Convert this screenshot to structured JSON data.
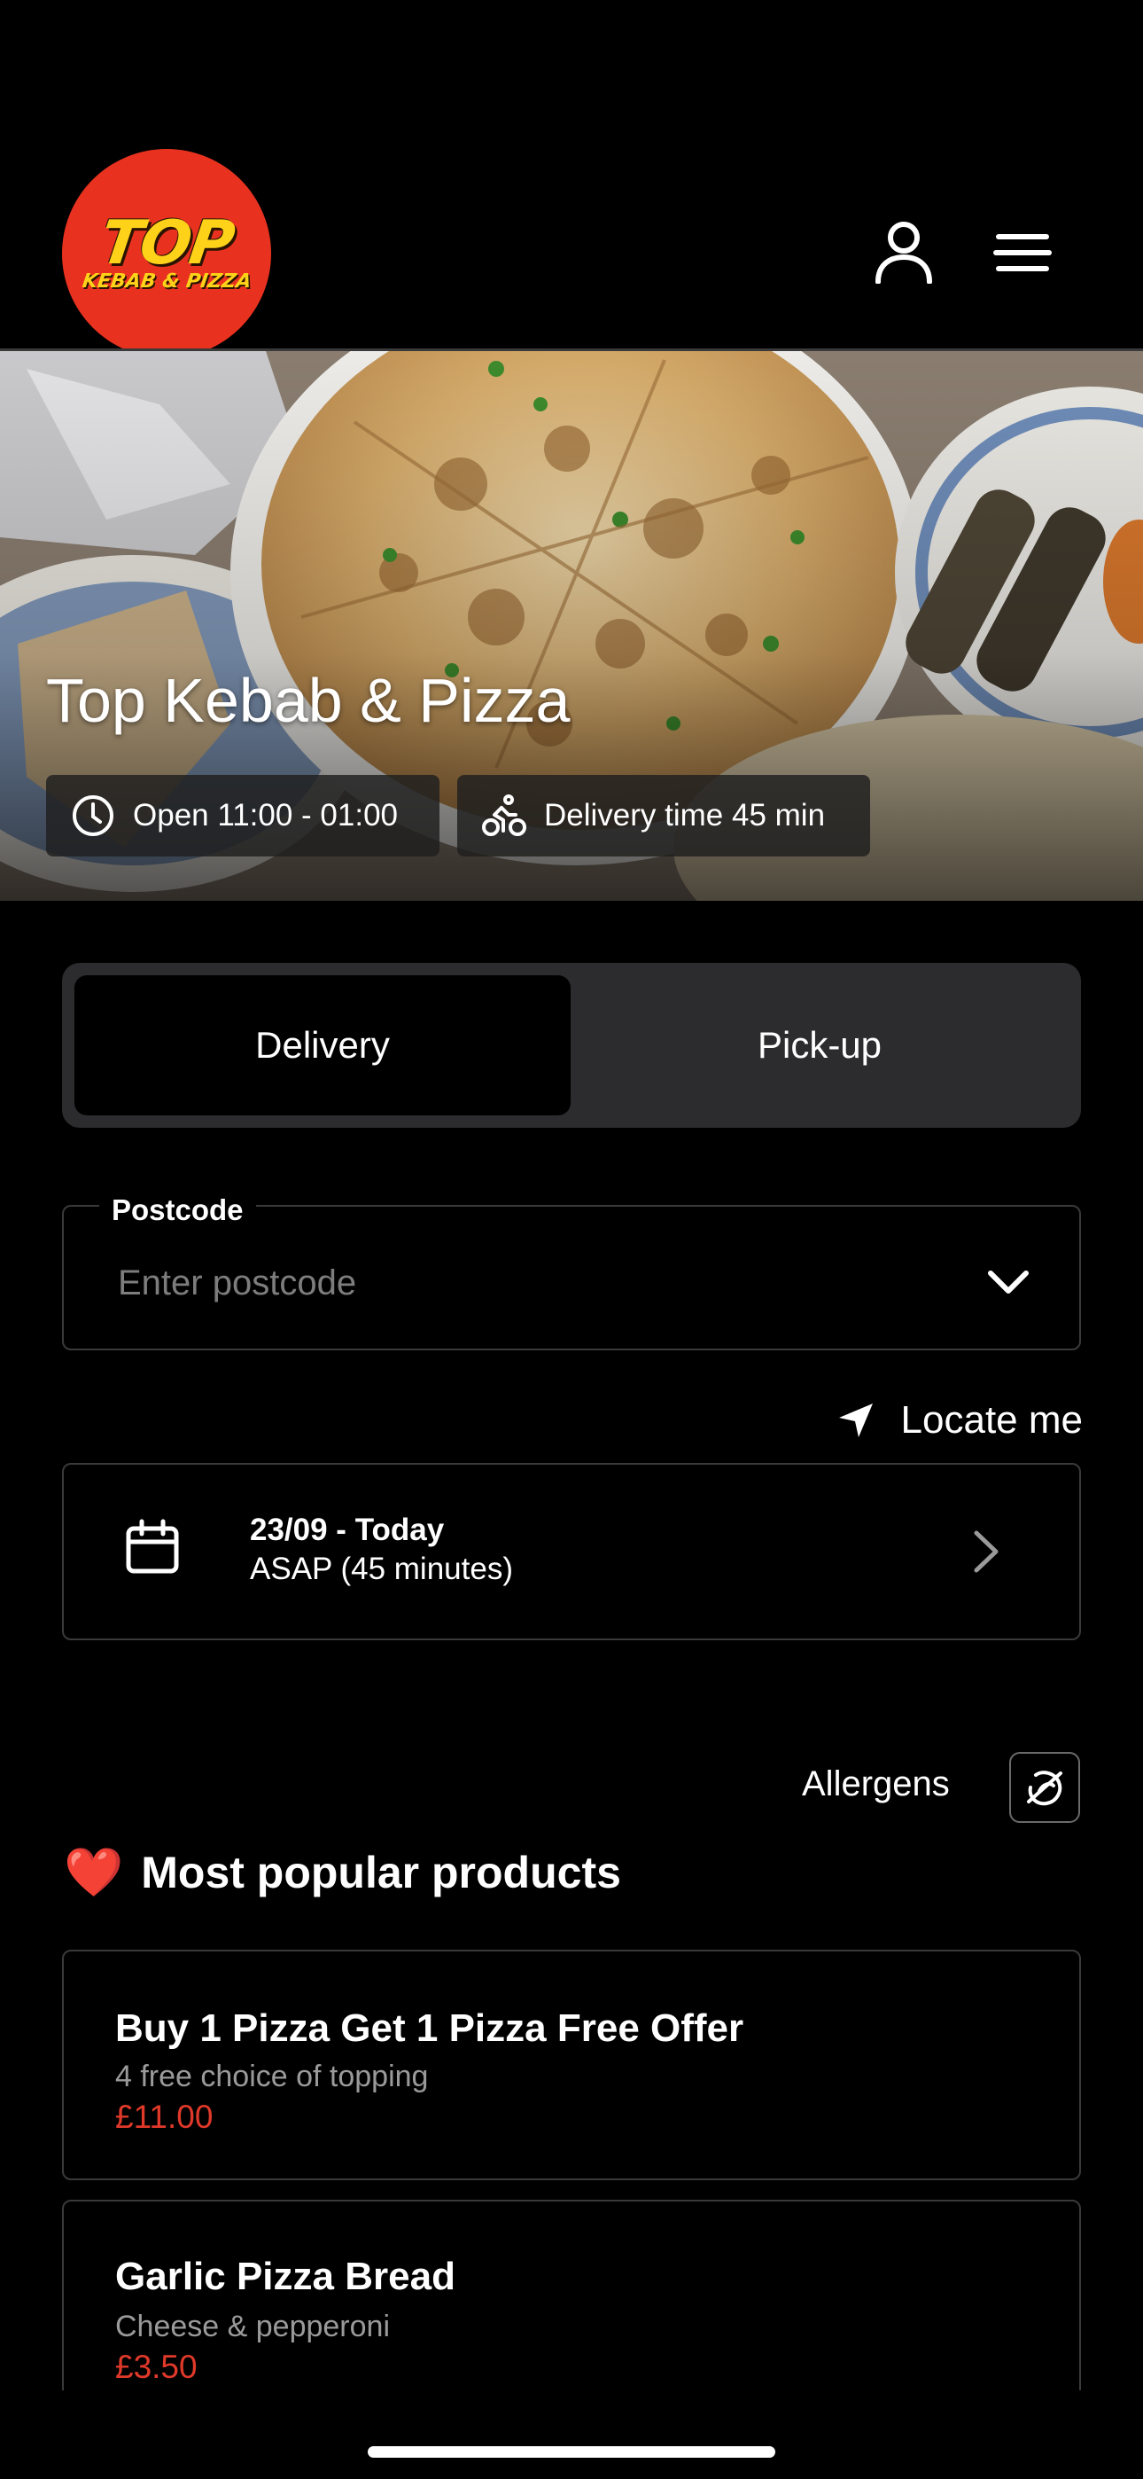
{
  "brand": {
    "logo_top": "TOP",
    "logo_sub": "KEBAB & PIZZA",
    "accent_color": "#e8321f",
    "logo_text_color": "#ffd21a"
  },
  "header": {
    "account_icon": "user-icon",
    "menu_icon": "hamburger-menu-icon"
  },
  "hero": {
    "title": "Top Kebab & Pizza",
    "opening_hours": "Open 11:00 - 01:00",
    "delivery_time": "Delivery time 45 min",
    "clock_icon": "clock-icon",
    "bike_icon": "bicycle-icon"
  },
  "order_type": {
    "options": [
      "Delivery",
      "Pick-up"
    ],
    "selected": "Delivery"
  },
  "postcode": {
    "label": "Postcode",
    "placeholder": "Enter postcode",
    "value": ""
  },
  "locate": {
    "label": "Locate me",
    "icon": "location-arrow-icon"
  },
  "schedule": {
    "date": "23/09 - Today",
    "time": "ASAP (45 minutes)",
    "icon": "calendar-icon"
  },
  "allergens": {
    "label": "Allergens",
    "icon": "allergens-icon"
  },
  "popular": {
    "emoji": "❤️",
    "title": "Most popular products",
    "items": [
      {
        "name": "Buy 1 Pizza Get 1 Pizza Free Offer",
        "description": "4 free choice of topping",
        "price": "£11.00"
      },
      {
        "name": "Garlic Pizza Bread",
        "description": "Cheese & pepperoni",
        "price": "£3.50"
      }
    ]
  },
  "colors": {
    "price": "#e0392a",
    "card_border": "#3a3a3a",
    "toggle_bg": "#2c2c2e"
  }
}
